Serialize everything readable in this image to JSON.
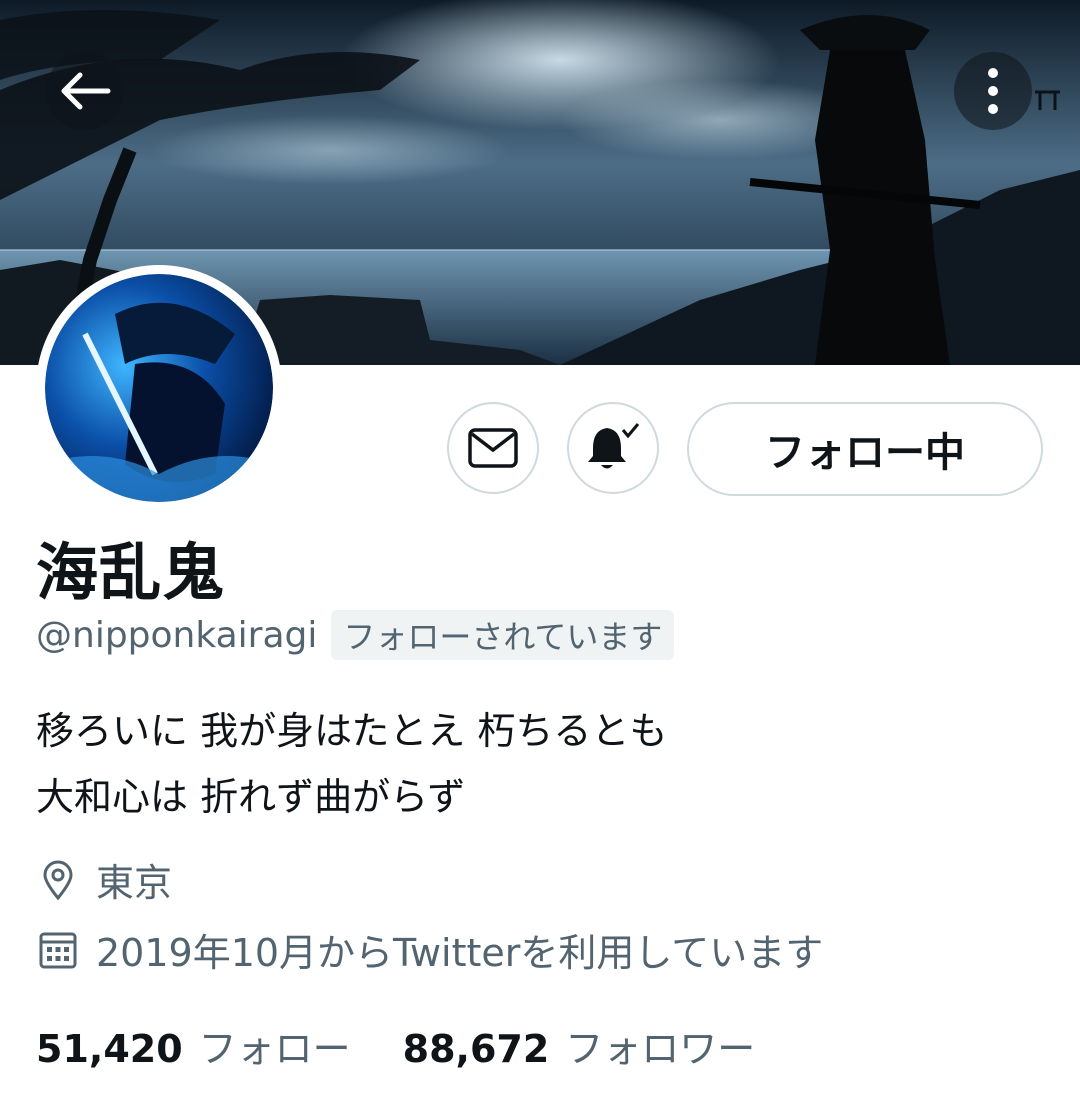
{
  "header": {
    "back_icon": "arrow-left-icon",
    "more_icon": "vertical-dots-icon"
  },
  "profile": {
    "display_name": "海乱鬼",
    "handle": "@nipponkairagi",
    "follows_you_badge": "フォローされています",
    "bio_lines": [
      "移ろいに 我が身はたとえ 朽ちるとも",
      "大和心は 折れず曲がらず"
    ],
    "location": "東京",
    "joined": "2019年10月からTwitterを利用しています"
  },
  "actions": {
    "message_icon": "envelope-icon",
    "notify_icon": "bell-check-icon",
    "follow_label": "フォロー中"
  },
  "stats": {
    "following_count": "51,420",
    "following_label": "フォロー",
    "followers_count": "88,672",
    "followers_label": "フォロワー"
  },
  "colors": {
    "text_primary": "#0f1419",
    "text_secondary": "#536471",
    "border": "#cfd9de",
    "badge_bg": "#eff3f4"
  }
}
